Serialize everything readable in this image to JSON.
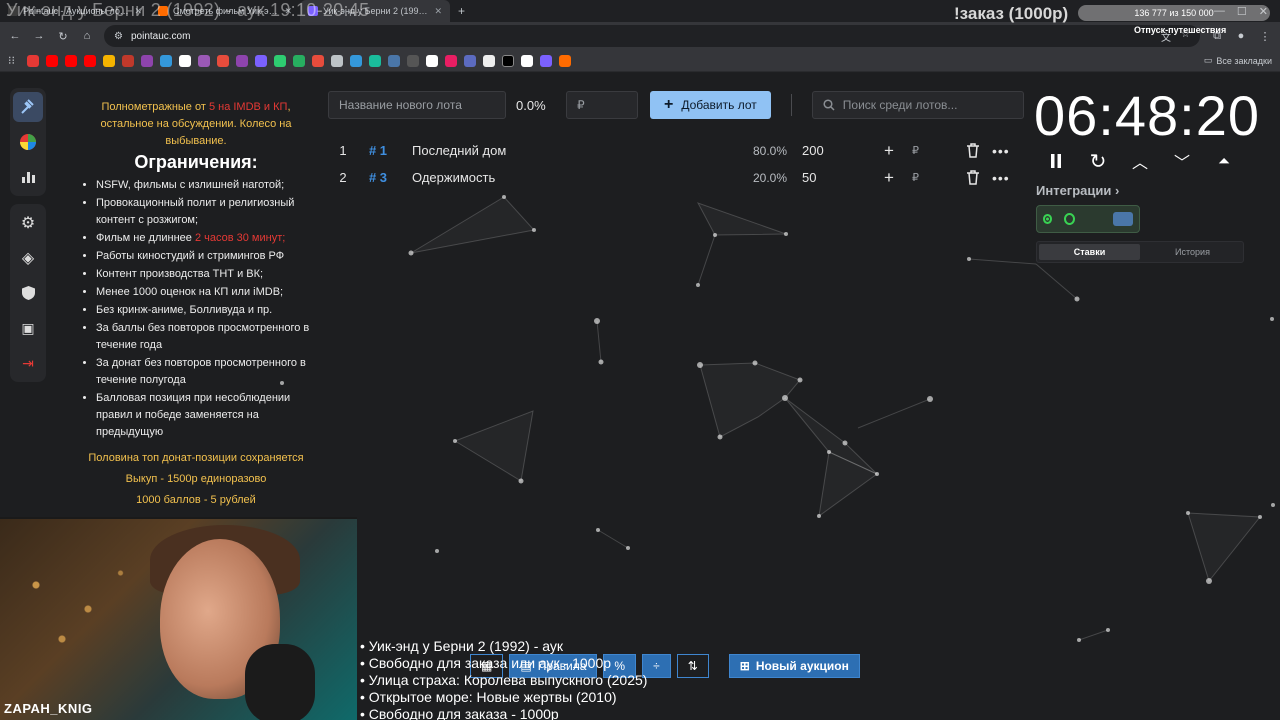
{
  "browser": {
    "tabs": [
      {
        "title": "Pointauc - Аукционы лотов"
      },
      {
        "title": "Смотреть фильм Уик-энд у Берни"
      },
      {
        "title": "Уик-энд у Берни 2 (1992) - Kin"
      }
    ],
    "url": "pointauc.com",
    "bookmarks_label": "Все закладки"
  },
  "overlay": {
    "stream_title": "Уик-энд у Берни 2 (1992) - аук 19:10-20:45",
    "order_label": "!заказ (1000р)",
    "goal_progress": "136 777 из 150 000",
    "goal_name": "Отпуск-путешествия"
  },
  "rules": {
    "note_prefix": "Полнометражные от ",
    "note_red": "5 на IMDB и КП",
    "note_suffix": ", остальное на обсуждении. Колесо на выбывание.",
    "heading": "Ограничения:",
    "items": [
      "NSFW, фильмы с излишней наготой;",
      "Провокационный полит и религиозный контент с розжигом;",
      "Фильм не длиннее ",
      "Работы киностудий и стримингов РФ",
      "Контент производства ТНТ и ВК;",
      "Менее 1000 оценок на КП или iMDB;",
      "Без кринж-аниме, Болливуда и пр.",
      "За баллы без повторов просмотренного в течение года",
      "За донат без повторов просмотренного в течение полугода",
      "Балловая позиция при несоблюдении правил и победе заменяется на предыдущую"
    ],
    "duration_red": "2 часов 30 минут;",
    "gold_lines": [
      "Половина топ донат-позиции сохраняется",
      "Выкуп - 1500р единоразово",
      "1000 баллов - 5 рублей"
    ]
  },
  "toolbar": {
    "lot_name_placeholder": "Название нового лота",
    "percent": "0.0%",
    "amount_placeholder": "₽",
    "add_label": "Добавить лот",
    "search_placeholder": "Поиск среди лотов..."
  },
  "lots": [
    {
      "index": "1",
      "id": "# 1",
      "name": "Последний дом",
      "percent": "80.0%",
      "amount": "200",
      "currency": "₽"
    },
    {
      "index": "2",
      "id": "# 3",
      "name": "Одержимость",
      "percent": "20.0%",
      "amount": "50",
      "currency": "₽"
    }
  ],
  "timer": {
    "value": "06:48:20"
  },
  "integrations": {
    "label": "Интеграции ›",
    "tabs": [
      "Ставки",
      "История"
    ]
  },
  "webcam": {
    "nick": "ZAPAH_KNIG"
  },
  "ticker": [
    "• Уик-энд у Берни 2 (1992) - аук",
    "• Свободно для заказа или аук - 1000р",
    "• Улица страха: Королева выпускного (2025)",
    "• Открытое море: Новые жертвы (2010)",
    "• Свободно для заказа - 1000р"
  ],
  "bottombar": {
    "rules_label": "Правила",
    "new_auction_label": "Новый аукцион"
  },
  "colors": {
    "accent": "#90c2f4",
    "hash": "#3f8fe0",
    "gold": "#f2c14e",
    "red": "#e53935"
  }
}
